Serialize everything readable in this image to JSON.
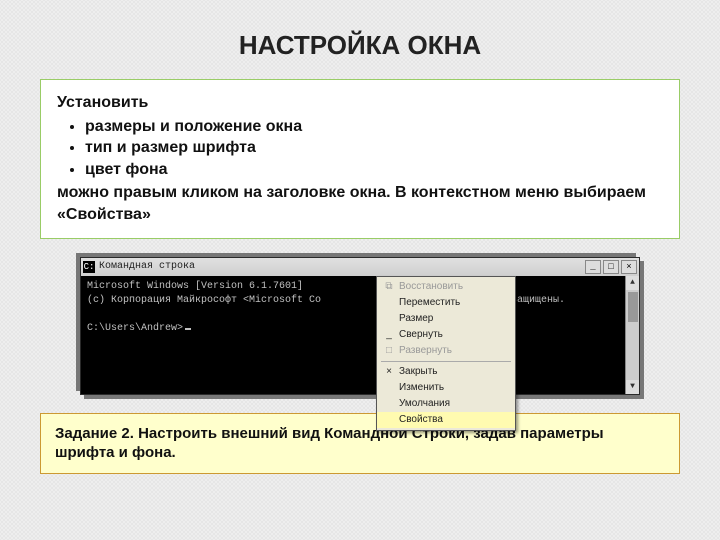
{
  "page": {
    "title": "НАСТРОЙКА ОКНА"
  },
  "panel": {
    "lead": "Установить",
    "items": [
      "размеры и положение окна",
      "тип и размер шрифта",
      "цвет фона"
    ],
    "tail": "можно правым кликом на заголовке окна. В контекстном меню выбираем «Свойства»"
  },
  "cmd": {
    "title": "Командная строка",
    "line1": "Microsoft Windows [Version 6.1.7601]",
    "line2_left": "(c) Корпорация Майкрософт <Microsoft Co",
    "line2_right": "рава защищены.",
    "prompt": "C:\\Users\\Andrew>"
  },
  "menu": {
    "restore": "Восстановить",
    "move": "Переместить",
    "size": "Размер",
    "minimize": "Свернуть",
    "maximize": "Развернуть",
    "close": "Закрыть",
    "edit": "Изменить",
    "defaults": "Умолчания",
    "properties": "Свойства"
  },
  "task": {
    "lead": "Задание 2.  ",
    "body": "Настроить внешний вид Командной Строки, задав параметры шрифта и фона."
  }
}
